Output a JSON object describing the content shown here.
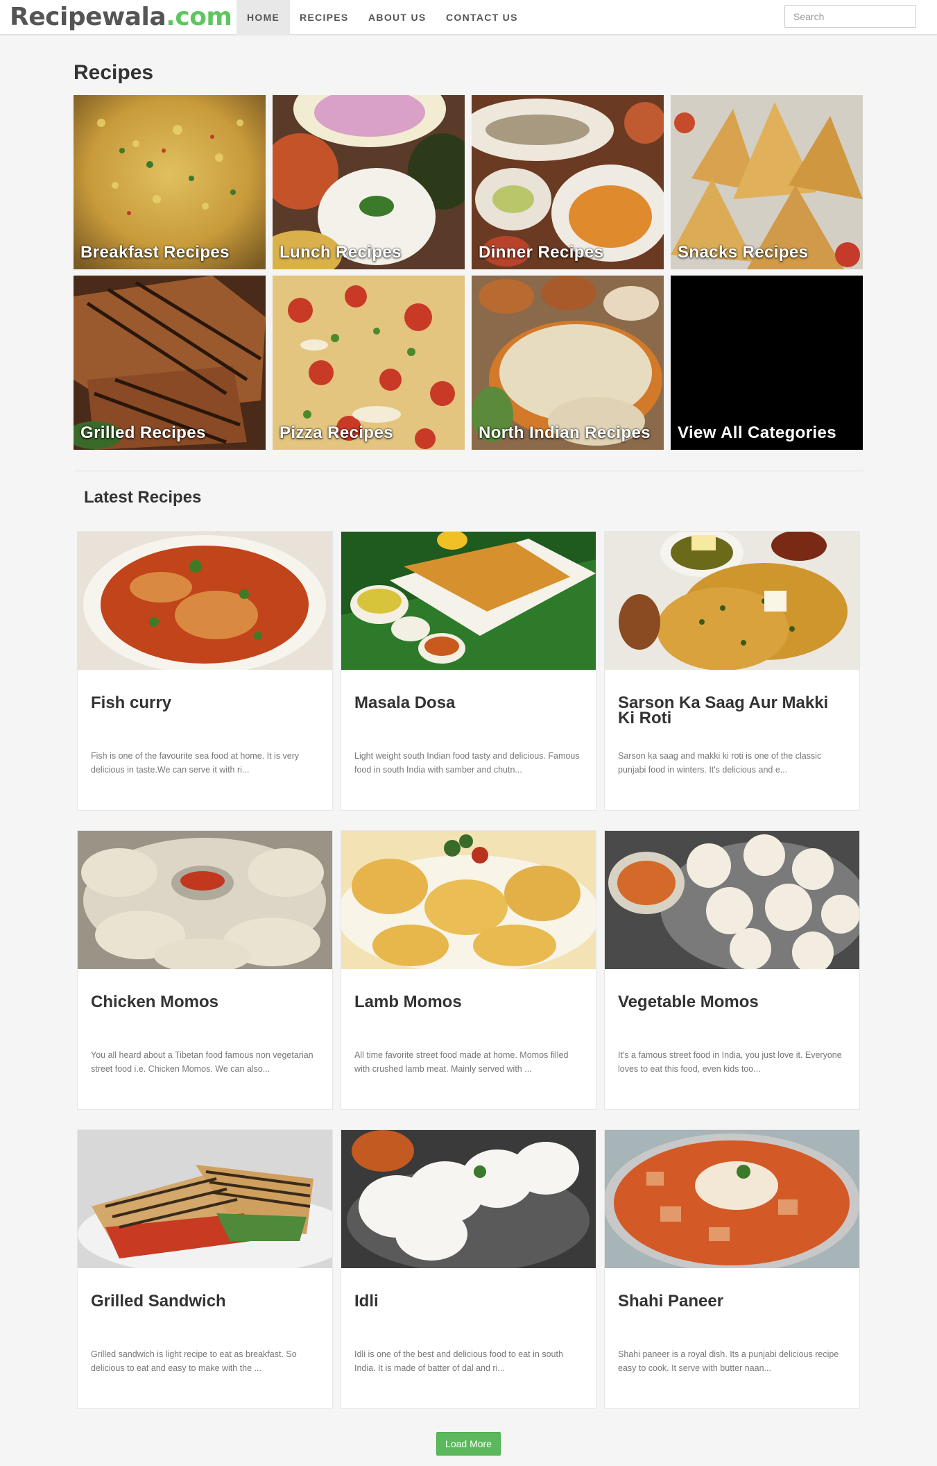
{
  "brand": {
    "part1": "Recipewala",
    "part2": ".com"
  },
  "nav": [
    {
      "label": "HOME",
      "active": true
    },
    {
      "label": "RECIPES",
      "active": false
    },
    {
      "label": "ABOUT US",
      "active": false
    },
    {
      "label": "CONTACT US",
      "active": false
    }
  ],
  "search": {
    "placeholder": "Search"
  },
  "recipes_section": {
    "title": "Recipes"
  },
  "categories": [
    {
      "label": "Breakfast Recipes"
    },
    {
      "label": "Lunch Recipes"
    },
    {
      "label": "Dinner Recipes"
    },
    {
      "label": "Snacks Recipes"
    },
    {
      "label": "Grilled Recipes"
    },
    {
      "label": "Pizza Recipes"
    },
    {
      "label": "North Indian Recipes"
    },
    {
      "label": "View All Categories"
    }
  ],
  "latest_section": {
    "title": "Latest Recipes"
  },
  "latest": [
    {
      "title": "Fish curry",
      "desc": "Fish is one of the favourite sea food at home. It is very delicious in taste.We can serve it with ri..."
    },
    {
      "title": "Masala Dosa",
      "desc": "Light weight south Indian food tasty and delicious. Famous food in south India with samber and chutn..."
    },
    {
      "title": "Sarson Ka Saag Aur Makki Ki Roti",
      "desc": "Sarson ka saag and makki ki roti is one of the classic punjabi food in winters. It's delicious and e..."
    },
    {
      "title": "Chicken Momos",
      "desc": "You all heard about a Tibetan food famous non vegetarian street food i.e. Chicken Momos. We can also..."
    },
    {
      "title": "Lamb Momos",
      "desc": "All time favorite street food made at home. Momos filled with crushed lamb meat. Mainly served with ..."
    },
    {
      "title": "Vegetable Momos",
      "desc": "It's a famous street food in India, you just love it. Everyone loves to eat this food, even kids too..."
    },
    {
      "title": "Grilled Sandwich",
      "desc": "Grilled sandwich is light recipe to eat as breakfast. So delicious to eat and easy to make with the ..."
    },
    {
      "title": "Idli",
      "desc": "Idli is one of the best and delicious food to eat in south India. It is made of batter of dal and ri..."
    },
    {
      "title": "Shahi Paneer",
      "desc": "Shahi paneer is a royal dish. Its a punjabi delicious recipe easy to cook. It serve with butter naan..."
    }
  ],
  "load_more": {
    "label": "Load More"
  }
}
